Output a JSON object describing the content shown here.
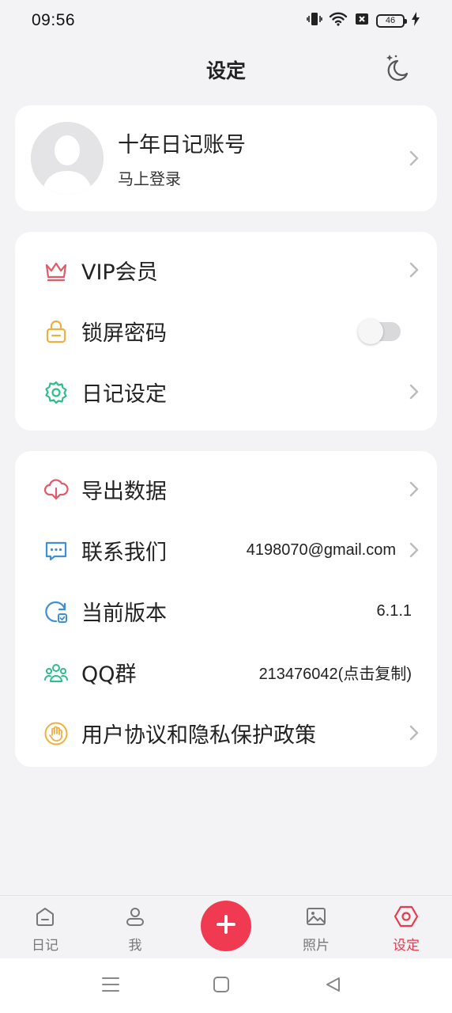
{
  "status_bar": {
    "time": "09:56",
    "battery": "46"
  },
  "header": {
    "title": "设定"
  },
  "profile": {
    "name": "十年日记账号",
    "subtitle": "马上登录"
  },
  "menu_group_1": [
    {
      "label": "VIP会员",
      "icon": "crown-icon"
    },
    {
      "label": "锁屏密码",
      "icon": "lock-icon",
      "toggle_on": false
    },
    {
      "label": "日记设定",
      "icon": "gear-icon"
    }
  ],
  "menu_group_2": [
    {
      "label": "导出数据",
      "icon": "cloud-download-icon"
    },
    {
      "label": "联系我们",
      "icon": "chat-icon",
      "value": "4198070@gmail.com"
    },
    {
      "label": "当前版本",
      "icon": "update-icon",
      "value": "6.1.1"
    },
    {
      "label": "QQ群",
      "icon": "group-icon",
      "value": "213476042(点击复制)"
    },
    {
      "label": "用户协议和隐私保护政策",
      "icon": "hand-icon"
    }
  ],
  "tabs": [
    {
      "label": "日记",
      "icon": "home-icon",
      "active": false
    },
    {
      "label": "我",
      "icon": "person-icon",
      "active": false
    },
    {
      "label": "照片",
      "icon": "image-icon",
      "active": false
    },
    {
      "label": "设定",
      "icon": "hexagon-settings-icon",
      "active": true
    }
  ],
  "colors": {
    "accent": "#f03a52",
    "crown": "#e05a6a",
    "lock": "#f0b040",
    "gear": "#2bbf8a",
    "cloud": "#e05a6a",
    "chat": "#3d8fd8",
    "update": "#3d8fd8",
    "group": "#2bbf8a",
    "hand": "#f0b040"
  }
}
